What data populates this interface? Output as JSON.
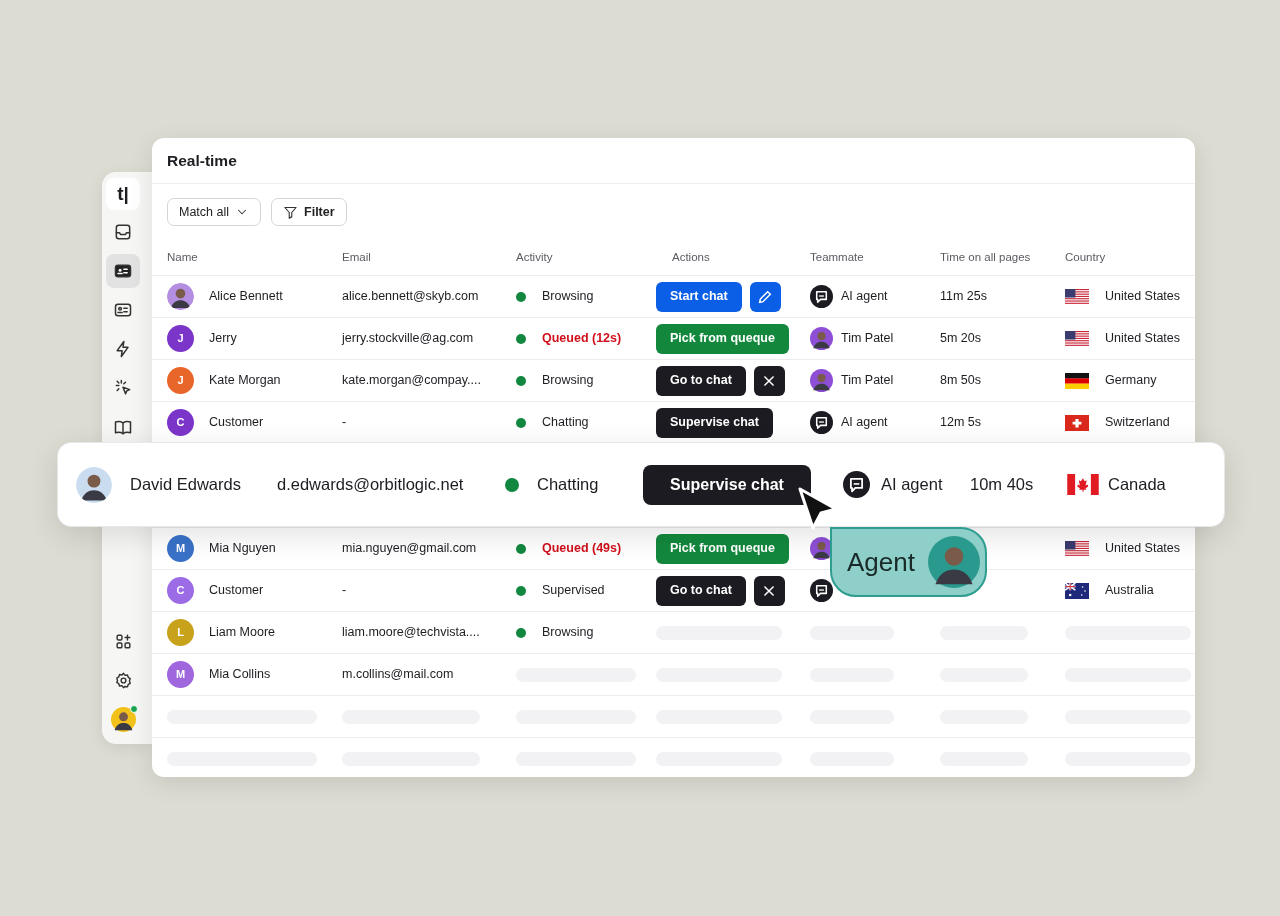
{
  "sidebar": {
    "logo": "t|",
    "items": [
      {
        "selected": false
      },
      {
        "selected": true
      },
      {
        "selected": false
      },
      {
        "selected": false
      },
      {
        "selected": false
      },
      {
        "selected": false
      }
    ],
    "bottom_items": [
      {
        "selected": false
      },
      {
        "selected": false
      }
    ],
    "user": {
      "online": true
    }
  },
  "panel": {
    "title": "Real-time",
    "match_dropdown": "Match all",
    "filter_button": "Filter"
  },
  "table": {
    "columns": [
      "Name",
      "Email",
      "Activity",
      "Actions",
      "Teammate",
      "Time on all pages",
      "Country"
    ],
    "rows": [
      {
        "name": "Alice Bennett",
        "avatar": {
          "kind": "photo",
          "color": "#b48ee0"
        },
        "email": "alice.bennett@skyb.com",
        "activity": "Browsing",
        "queued": false,
        "actions": [
          {
            "kind": "primary",
            "label": "Start chat"
          },
          {
            "kind": "edit"
          }
        ],
        "teammate": {
          "kind": "ai",
          "name": "AI agent"
        },
        "time": "11m 25s",
        "flag": {
          "kind": "us"
        },
        "country": "United States"
      },
      {
        "name": "Jerry",
        "avatar": {
          "kind": "initial",
          "initial": "J",
          "color": "#7b35c9"
        },
        "email": "jerry.stockville@ag.com",
        "activity": "Queued (12s)",
        "queued": true,
        "actions": [
          {
            "kind": "success",
            "label": "Pick from queque"
          }
        ],
        "teammate": {
          "kind": "person",
          "name": "Tim Patel"
        },
        "time": "5m 20s",
        "flag": {
          "kind": "us"
        },
        "country": "United States"
      },
      {
        "name": "Kate Morgan",
        "avatar": {
          "kind": "initial",
          "initial": "J",
          "color": "#e8662a"
        },
        "email": "kate.morgan@compay....",
        "activity": "Browsing",
        "queued": false,
        "actions": [
          {
            "kind": "dark",
            "label": "Go to chat"
          },
          {
            "kind": "close"
          }
        ],
        "teammate": {
          "kind": "person",
          "name": "Tim Patel"
        },
        "time": "8m 50s",
        "flag": {
          "kind": "de"
        },
        "country": "Germany"
      },
      {
        "name": "Customer",
        "avatar": {
          "kind": "initial",
          "initial": "C",
          "color": "#7b35c9"
        },
        "email": "-",
        "activity": "Chatting",
        "queued": false,
        "actions": [
          {
            "kind": "dark",
            "label": "Supervise chat"
          }
        ],
        "teammate": {
          "kind": "ai",
          "name": "AI agent"
        },
        "time": "12m 5s",
        "flag": {
          "kind": "ch"
        },
        "country": "Switzerland"
      }
    ],
    "rows_below": [
      {
        "kind": "contact",
        "name": "Mia Nguyen",
        "avatar": {
          "kind": "initial",
          "initial": "M",
          "color": "#3a72c9"
        },
        "email": "mia.nguyen@gmail.com",
        "activity": "Queued (49s)",
        "queued": true,
        "actions": [
          {
            "kind": "success",
            "label": "Pick from queque"
          }
        ],
        "teammate": {
          "kind": "person"
        },
        "flag": {
          "kind": "us"
        },
        "country": "United States"
      },
      {
        "kind": "contact",
        "name": "Customer",
        "avatar": {
          "kind": "initial",
          "initial": "C",
          "color": "#9b6ce6"
        },
        "email": "-",
        "activity": "Supervised",
        "queued": false,
        "actions": [
          {
            "kind": "dark",
            "label": "Go to chat"
          },
          {
            "kind": "close"
          }
        ],
        "teammate": {
          "kind": "ai"
        },
        "flag": {
          "kind": "au"
        },
        "country": "Australia"
      },
      {
        "kind": "contact",
        "name": "Liam Moore",
        "avatar": {
          "kind": "initial",
          "initial": "L",
          "color": "#c9a21c"
        },
        "email": "liam.moore@techvista....",
        "activity": "Browsing",
        "queued": false
      },
      {
        "kind": "contact",
        "name": "Mia Collins",
        "avatar": {
          "kind": "initial",
          "initial": "M",
          "color": "#a066dd"
        },
        "email": "m.collins@mail.com"
      },
      {
        "kind": "loading"
      },
      {
        "kind": "loading"
      }
    ]
  },
  "highlight_row": {
    "name": "David Edwards",
    "avatar": {
      "kind": "photo",
      "color": "#c9dcf0"
    },
    "email": "d.edwards@orbitlogic.net",
    "activity": "Chatting",
    "action": "Supervise chat",
    "teammate": {
      "kind": "ai",
      "name": "AI agent"
    },
    "time": "10m 40s",
    "flag": {
      "kind": "ca"
    },
    "country": "Canada"
  },
  "agent_badge": {
    "label": "Agent"
  }
}
